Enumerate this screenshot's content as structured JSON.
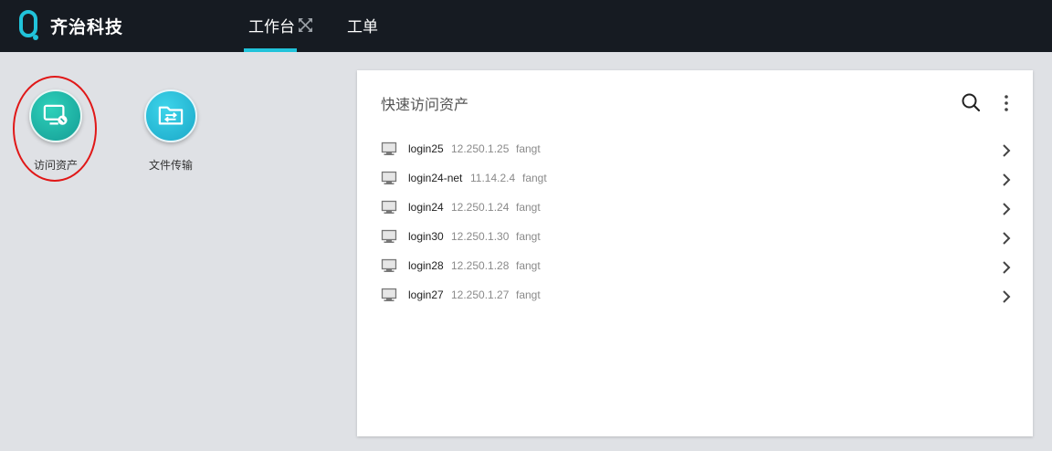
{
  "header": {
    "brand": "齐治科技",
    "tabs": [
      {
        "label": "工作台",
        "active": true
      },
      {
        "label": "工单",
        "active": false
      }
    ],
    "accent_color": "#21c3da",
    "background_color": "#161b22"
  },
  "apps": [
    {
      "label": "访问资产",
      "icon": "monitor-icon",
      "color": "#1aa89e"
    },
    {
      "label": "文件传输",
      "icon": "file-transfer-icon",
      "color": "#25b9d8"
    }
  ],
  "panel": {
    "title": "快速访问资产",
    "assets": [
      {
        "name": "login25",
        "ip": "12.250.1.25",
        "user": "fangt"
      },
      {
        "name": "login24-net",
        "ip": "11.14.2.4",
        "user": "fangt"
      },
      {
        "name": "login24",
        "ip": "12.250.1.24",
        "user": "fangt"
      },
      {
        "name": "login30",
        "ip": "12.250.1.30",
        "user": "fangt"
      },
      {
        "name": "login28",
        "ip": "12.250.1.28",
        "user": "fangt"
      },
      {
        "name": "login27",
        "ip": "12.250.1.27",
        "user": "fangt"
      }
    ]
  }
}
